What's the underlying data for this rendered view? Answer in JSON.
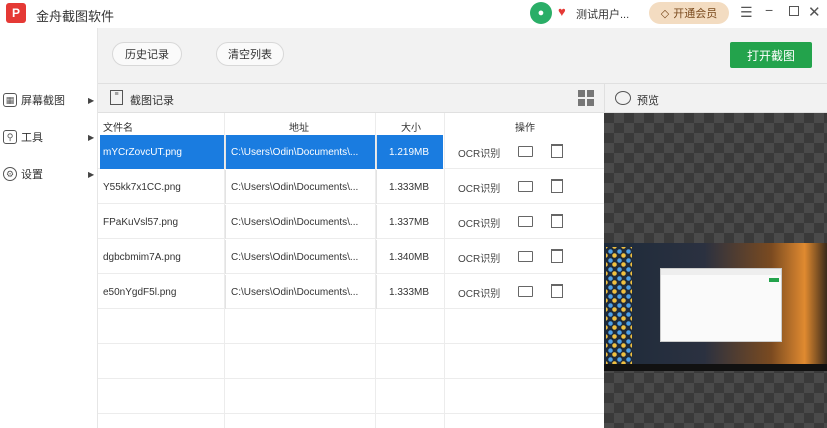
{
  "app": {
    "logo_text": "P",
    "title": "金舟截图软件"
  },
  "titlebar": {
    "user_name": "测试用户...",
    "vip_label": "开通会员",
    "vip_icon": "◇",
    "menu": "☰",
    "minimize": "−",
    "close": "✕"
  },
  "sidebar": {
    "items": [
      {
        "label": "屏幕截图",
        "icon": "▦"
      },
      {
        "label": "工具",
        "icon": "⚲"
      },
      {
        "label": "设置",
        "icon": "⚙"
      }
    ],
    "arrow": "▶"
  },
  "toolbar": {
    "history_label": "历史记录",
    "clear_label": "清空列表",
    "open_label": "打开截图"
  },
  "list": {
    "title": "截图记录",
    "columns": {
      "name": "文件名",
      "path": "地址",
      "size": "大小",
      "actions": "操作"
    },
    "rows": [
      {
        "name": "mYCrZovcUT.png",
        "path": "C:\\Users\\Odin\\Documents\\...",
        "size": "1.219MB",
        "ocr": "OCR识别"
      },
      {
        "name": "Y55kk7x1CC.png",
        "path": "C:\\Users\\Odin\\Documents\\...",
        "size": "1.333MB",
        "ocr": "OCR识别"
      },
      {
        "name": "FPaKuVsl57.png",
        "path": "C:\\Users\\Odin\\Documents\\...",
        "size": "1.337MB",
        "ocr": "OCR识别"
      },
      {
        "name": "dgbcbmim7A.png",
        "path": "C:\\Users\\Odin\\Documents\\...",
        "size": "1.340MB",
        "ocr": "OCR识别"
      },
      {
        "name": "e50nYgdF5l.png",
        "path": "C:\\Users\\Odin\\Documents\\...",
        "size": "1.333MB",
        "ocr": "OCR识别"
      }
    ],
    "selected_index": 0
  },
  "preview": {
    "title": "预览"
  },
  "colors": {
    "accent_green": "#23a34c",
    "selection_blue": "#1a7ce0",
    "vip_bg": "#f3dcc1",
    "wechat_green": "#2aae67"
  }
}
